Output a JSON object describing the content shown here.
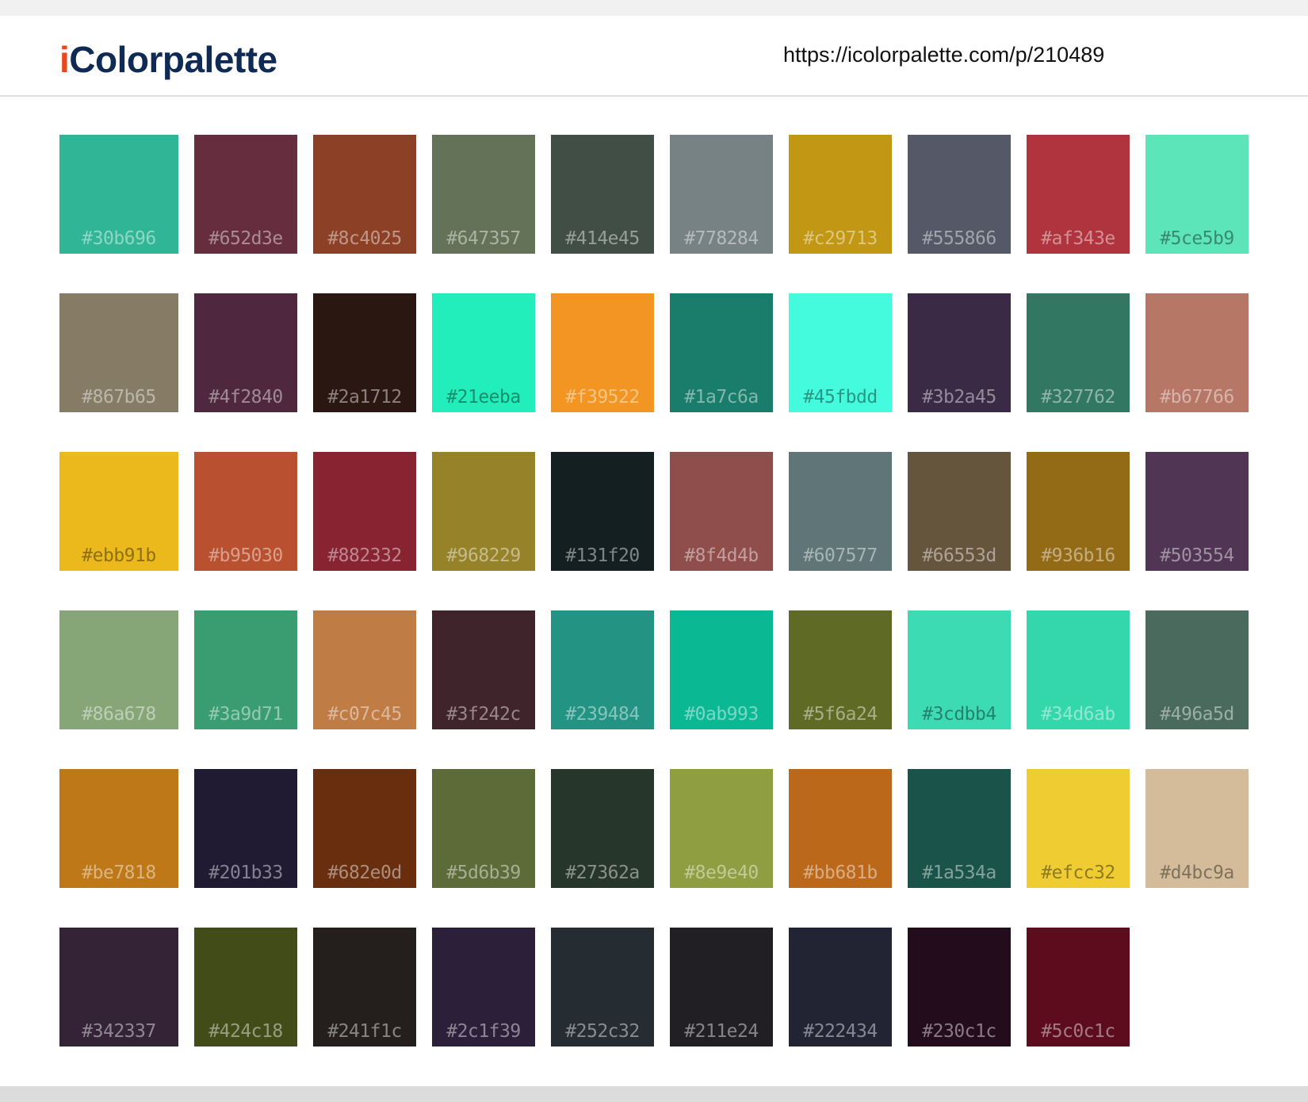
{
  "header": {
    "logo_i": "i",
    "logo_rest": "Colorpalette",
    "url": "https://icolorpalette.com/p/210489"
  },
  "swatches": [
    "#30b696",
    "#652d3e",
    "#8c4025",
    "#647357",
    "#414e45",
    "#778284",
    "#c29713",
    "#555866",
    "#af343e",
    "#5ce5b9",
    "#867b65",
    "#4f2840",
    "#2a1712",
    "#21eeba",
    "#f39522",
    "#1a7c6a",
    "#45fbdd",
    "#3b2a45",
    "#327762",
    "#b67766",
    "#ebb91b",
    "#b95030",
    "#882332",
    "#968229",
    "#131f20",
    "#8f4d4b",
    "#607577",
    "#66553d",
    "#936b16",
    "#503554",
    "#86a678",
    "#3a9d71",
    "#c07c45",
    "#3f242c",
    "#239484",
    "#0ab993",
    "#5f6a24",
    "#3cdbb4",
    "#34d6ab",
    "#496a5d",
    "#be7818",
    "#201b33",
    "#682e0d",
    "#5d6b39",
    "#27362a",
    "#8e9e40",
    "#bb681b",
    "#1a534a",
    "#efcc32",
    "#d4bc9a",
    "#342337",
    "#424c18",
    "#241f1c",
    "#2c1f39",
    "#252c32",
    "#211e24",
    "#222434",
    "#230c1c",
    "#5c0c1c"
  ]
}
